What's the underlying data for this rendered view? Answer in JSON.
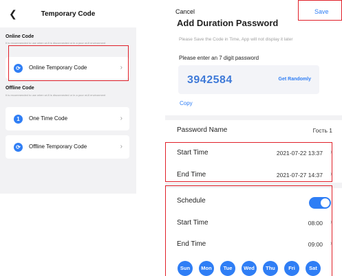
{
  "left_screen": {
    "back_icon": "chevron-left-icon",
    "title": "Temporary Code",
    "online_section": {
      "title": "Online Code",
      "description": "It is recommended to use when wi-fi is disconnected or in a poor wi-fi environment",
      "items": [
        {
          "icon": "sync-icon",
          "label": "Online Temporary Code"
        }
      ]
    },
    "offline_section": {
      "title": "Offline Code",
      "description": "It is recommended to use when wi-fi is disconnected or in a poor wi-fi environment",
      "items": [
        {
          "icon_text": "1",
          "label": "One Time Code"
        },
        {
          "icon": "sync-icon",
          "label": "Offline Temporary Code"
        }
      ]
    }
  },
  "right_screen": {
    "cancel_label": "Cancel",
    "save_label": "Save",
    "title": "Add Duration Password",
    "note": "Please Save the Code in Time, App will not display it later",
    "prompt": "Please enter an 7 digit password",
    "password": "3942584",
    "get_randomly_label": "Get Randomly",
    "copy_label": "Copy",
    "password_name_label": "Password Name",
    "password_name_value": "Гость 1",
    "start_time_label": "Start Time",
    "start_time_value": "2021-07-22 13:37",
    "end_time_label": "End Time",
    "end_time_value": "2021-07-27 14:37",
    "schedule_label": "Schedule",
    "schedule_enabled": true,
    "schedule_start_label": "Start Time",
    "schedule_start_value": "08:00",
    "schedule_end_label": "End Time",
    "schedule_end_value": "09:00",
    "days": [
      "Sun",
      "Mon",
      "Tue",
      "Wed",
      "Thu",
      "Fri",
      "Sat"
    ],
    "accent_color": "#2f7ef5",
    "highlight_color": "#e01f28"
  }
}
